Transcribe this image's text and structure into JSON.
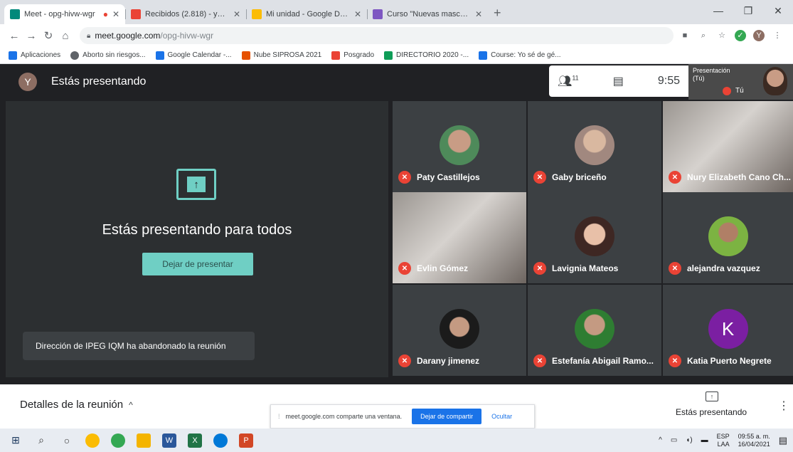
{
  "browser": {
    "tabs": [
      {
        "title": "Meet - opg-hivw-wgr",
        "color": "#00897b",
        "active": true
      },
      {
        "title": "Recibidos (2.818) - yarimemtz1",
        "color": "#ea4335",
        "active": false
      },
      {
        "title": "Mi unidad - Google Drive",
        "color": "#fbbc04",
        "active": false
      },
      {
        "title": "Curso \"Nuevas masculinidades\"",
        "color": "#7e57c2",
        "active": false
      }
    ],
    "url_host": "meet.google.com",
    "url_path": "/opg-hivw-wgr",
    "bookmarks": [
      {
        "label": "Aplicaciones",
        "color": "#1a73e8"
      },
      {
        "label": "Aborto sin riesgos...",
        "color": "#5f6368"
      },
      {
        "label": "Google Calendar -...",
        "color": "#1a73e8"
      },
      {
        "label": "Nube SIPROSA 2021",
        "color": "#e65100"
      },
      {
        "label": "Posgrado",
        "color": "#ea4335"
      },
      {
        "label": "DIRECTORIO 2020 -...",
        "color": "#0f9d58"
      },
      {
        "label": "Course: Yo sé de gé...",
        "color": "#1a73e8"
      }
    ]
  },
  "meet": {
    "user_initial": "Y",
    "presenting_title": "Estás presentando",
    "participants_count": "11",
    "clock": "9:55",
    "self_label_1": "Presentación",
    "self_label_2": "(Tú)",
    "self_name": "Tú",
    "present_message": "Estás presentando para todos",
    "stop_presenting": "Dejar de presentar",
    "toast": "Dirección de IPEG IQM ha abandonado la reunión",
    "participants": [
      {
        "name": "Paty Castillejos",
        "kind": "avatar",
        "color": "#4e8a5a"
      },
      {
        "name": "Gaby briceño",
        "kind": "avatar",
        "color": "#a1887f"
      },
      {
        "name": "Nury Elizabeth Cano Ch...",
        "kind": "video",
        "color": "#8d8a86"
      },
      {
        "name": "Evlin Gómez",
        "kind": "video",
        "color": "#8d8a86"
      },
      {
        "name": "Lavignia Mateos",
        "kind": "avatar",
        "color": "#d4a48c"
      },
      {
        "name": "alejandra vazquez",
        "kind": "avatar",
        "color": "#7cb342"
      },
      {
        "name": "Darany jimenez",
        "kind": "avatar",
        "color": "#3e2723"
      },
      {
        "name": "Estefanía Abigail Ramo...",
        "kind": "avatar",
        "color": "#2e7d32"
      },
      {
        "name": "Katia Puerto Negrete",
        "kind": "letter",
        "letter": "K",
        "color": "#7b1fa2"
      }
    ],
    "details_label": "Detalles de la reunión",
    "share_text": "meet.google.com comparte una ventana.",
    "share_stop": "Dejar de compartir",
    "share_hide": "Ocultar",
    "presenting_label": "Estás presentando"
  },
  "taskbar": {
    "lang_1": "ESP",
    "lang_2": "LAA",
    "time": "09:55 a. m.",
    "date": "16/04/2021"
  }
}
